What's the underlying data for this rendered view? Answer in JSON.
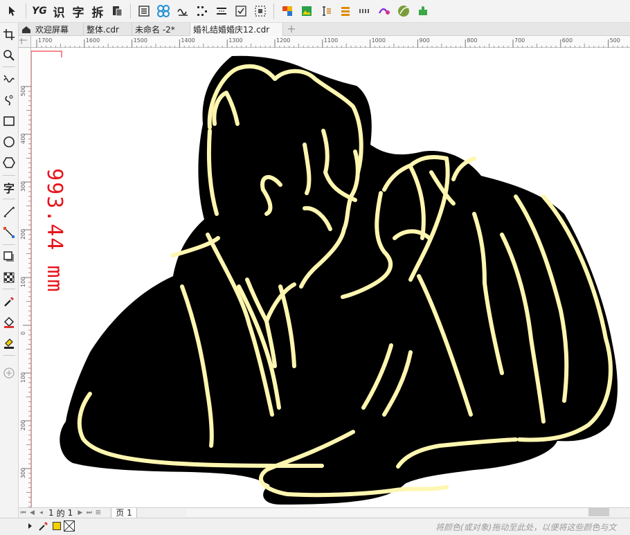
{
  "toolbar": {
    "yg_label": "YG",
    "recognize_label": "识",
    "char_label": "字",
    "split_label": "拆"
  },
  "toolbox": {
    "text_tool_label": "字"
  },
  "tabs": [
    {
      "label": "欢迎屏幕"
    },
    {
      "label": "整体.cdr"
    },
    {
      "label": "未命名 -2*"
    },
    {
      "label": "婚礼结婚婚庆12.cdr"
    }
  ],
  "ruler": {
    "h_ticks": [
      "1700",
      "1600",
      "1500",
      "1400",
      "1300",
      "1200",
      "1100",
      "1000",
      "900",
      "800",
      "700",
      "600",
      "500"
    ],
    "v_ticks": [
      "500",
      "400",
      "300",
      "200",
      "100",
      "0",
      "100",
      "200",
      "300"
    ]
  },
  "canvas": {
    "dimension_label": "993.44 mm",
    "colors": {
      "silhouette": "#000000",
      "line": "#fff6b0",
      "dimension": "#e8141b"
    }
  },
  "pagebar": {
    "current_page": "1",
    "of_label": "的",
    "total_pages": "1",
    "page_tab": "页 1"
  },
  "status": {
    "hint": "将颜色(或对象)拖动至此处，以便将这些颜色与文"
  }
}
